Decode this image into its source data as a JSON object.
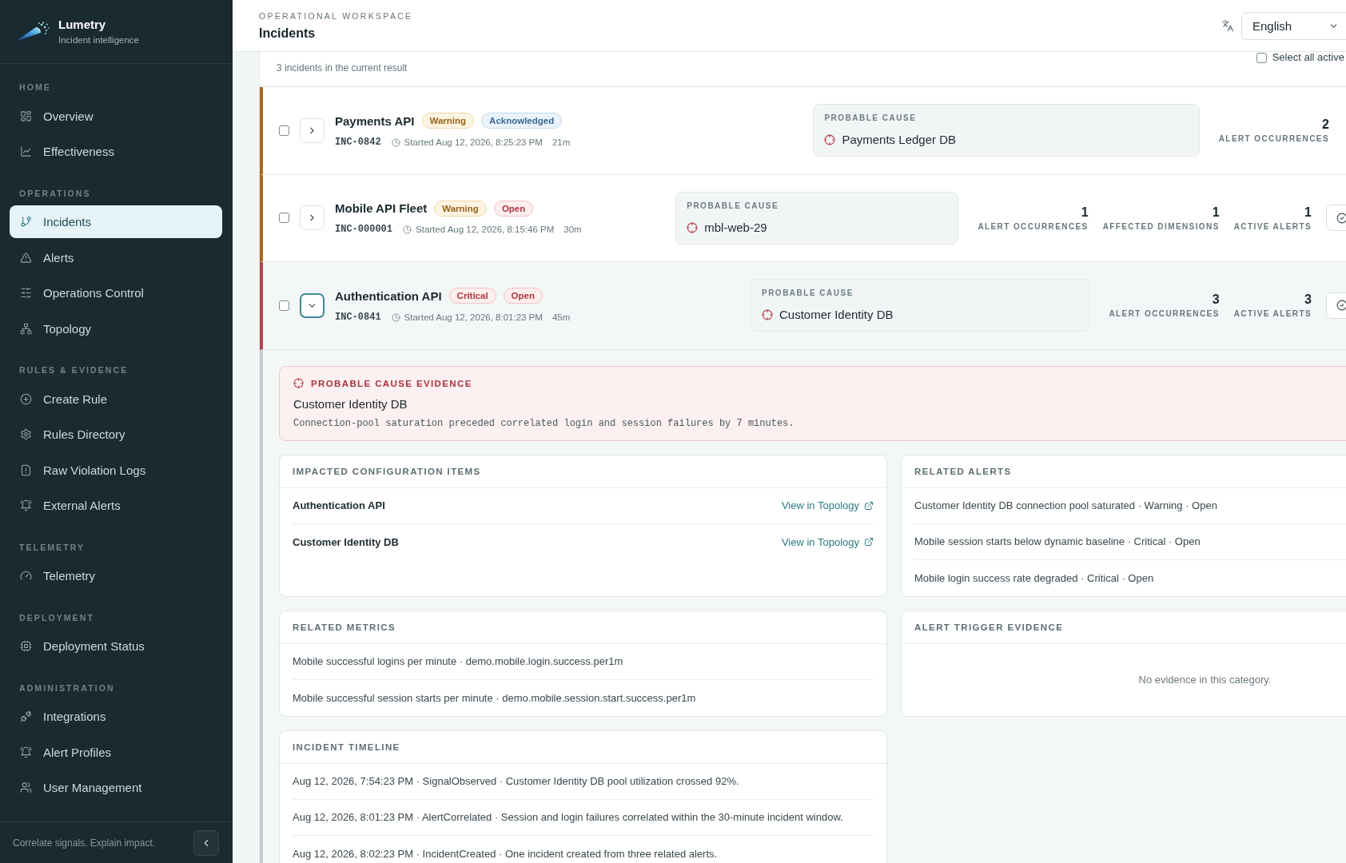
{
  "sidebar": {
    "brand": {
      "name": "Lumetry",
      "tagline": "Incident intelligence"
    },
    "sections": [
      {
        "title": "HOME",
        "items": [
          {
            "label": "Overview",
            "selected": false
          },
          {
            "label": "Effectiveness",
            "selected": false
          }
        ]
      },
      {
        "title": "OPERATIONS",
        "items": [
          {
            "label": "Incidents",
            "selected": true
          },
          {
            "label": "Alerts",
            "selected": false
          },
          {
            "label": "Operations Control",
            "selected": false
          },
          {
            "label": "Topology",
            "selected": false
          }
        ]
      },
      {
        "title": "RULES & EVIDENCE",
        "items": [
          {
            "label": "Create Rule",
            "selected": false
          },
          {
            "label": "Rules Directory",
            "selected": false
          },
          {
            "label": "Raw Violation Logs",
            "selected": false
          },
          {
            "label": "External Alerts",
            "selected": false
          }
        ]
      },
      {
        "title": "TELEMETRY",
        "items": [
          {
            "label": "Telemetry",
            "selected": false
          }
        ]
      },
      {
        "title": "DEPLOYMENT",
        "items": [
          {
            "label": "Deployment Status",
            "selected": false
          }
        ]
      },
      {
        "title": "ADMINISTRATION",
        "items": [
          {
            "label": "Integrations",
            "selected": false
          },
          {
            "label": "Alert Profiles",
            "selected": false
          },
          {
            "label": "User Management",
            "selected": false
          }
        ]
      }
    ],
    "footer": {
      "tagline": "Correlate signals. Explain impact."
    }
  },
  "header": {
    "eyebrow": "OPERATIONAL WORKSPACE",
    "title": "Incidents",
    "language": {
      "value": "English"
    }
  },
  "queue": {
    "summary": "3 incidents in the current result",
    "select_all": {
      "label": "Select all active",
      "checked": false
    },
    "incidents": [
      {
        "name": "Payments API",
        "badges": [
          {
            "label": "Warning",
            "kind": "warning"
          },
          {
            "label": "Acknowledged",
            "kind": "acknowledged"
          }
        ],
        "id": "INC-0842",
        "started": "Started Aug 12, 2026, 8:25:23 PM",
        "age": "21m",
        "checked": false,
        "expanded": false,
        "probable_cause": {
          "label": "PROBABLE CAUSE",
          "value": "Payments Ledger DB"
        },
        "stats": [
          {
            "value": "2",
            "label": "ALERT OCCURRENCES"
          }
        ],
        "acknowledge_button": false
      },
      {
        "name": "Mobile API Fleet",
        "badges": [
          {
            "label": "Warning",
            "kind": "warning"
          },
          {
            "label": "Open",
            "kind": "open"
          }
        ],
        "id": "INC-000001",
        "started": "Started Aug 12, 2026, 8:15:46 PM",
        "age": "30m",
        "checked": false,
        "expanded": false,
        "probable_cause": {
          "label": "PROBABLE CAUSE",
          "value": "mbl-web-29"
        },
        "stats": [
          {
            "value": "1",
            "label": "ALERT OCCURRENCES"
          },
          {
            "value": "1",
            "label": "AFFECTED DIMENSIONS"
          },
          {
            "value": "1",
            "label": "ACTIVE ALERTS"
          }
        ],
        "acknowledge_button": true
      },
      {
        "name": "Authentication API",
        "badges": [
          {
            "label": "Critical",
            "kind": "critical"
          },
          {
            "label": "Open",
            "kind": "open"
          }
        ],
        "id": "INC-0841",
        "started": "Started Aug 12, 2026, 8:01:23 PM",
        "age": "45m",
        "checked": false,
        "expanded": true,
        "probable_cause": {
          "label": "PROBABLE CAUSE",
          "value": "Customer Identity DB"
        },
        "stats": [
          {
            "value": "3",
            "label": "ALERT OCCURRENCES"
          },
          {
            "value": "3",
            "label": "ACTIVE ALERTS"
          }
        ],
        "acknowledge_button": true,
        "details": {
          "evidence": {
            "title": "PROBABLE CAUSE EVIDENCE",
            "name": "Customer Identity DB",
            "description": "Connection-pool saturation preceded correlated login and session failures by 7 minutes."
          },
          "panels": [
            {
              "title": "IMPACTED CONFIGURATION ITEMS",
              "kind": "config_items",
              "items": [
                {
                  "name": "Authentication API",
                  "link": "View in Topology"
                },
                {
                  "name": "Customer Identity DB",
                  "link": "View in Topology"
                }
              ]
            },
            {
              "title": "RELATED ALERTS",
              "kind": "alerts",
              "items": [
                "Customer Identity DB connection pool saturated · Warning · Open",
                "Mobile session starts below dynamic baseline · Critical · Open",
                "Mobile login success rate degraded · Critical · Open"
              ]
            },
            {
              "title": "RELATED METRICS",
              "kind": "metrics",
              "items": [
                "Mobile successful logins per minute · demo.mobile.login.success.per1m",
                "Mobile successful session starts per minute · demo.mobile.session.start.success.per1m"
              ]
            },
            {
              "title": "ALERT TRIGGER EVIDENCE",
              "kind": "empty",
              "empty_text": "No evidence in this category."
            },
            {
              "title": "INCIDENT TIMELINE",
              "kind": "timeline",
              "items": [
                "Aug 12, 2026, 7:54:23 PM · SignalObserved · Customer Identity DB pool utilization crossed 92%.",
                "Aug 12, 2026, 8:01:23 PM · AlertCorrelated · Session and login failures correlated within the 30-minute incident window.",
                "Aug 12, 2026, 8:02:23 PM · IncidentCreated · One incident created from three related alerts."
              ]
            }
          ]
        }
      }
    ]
  }
}
